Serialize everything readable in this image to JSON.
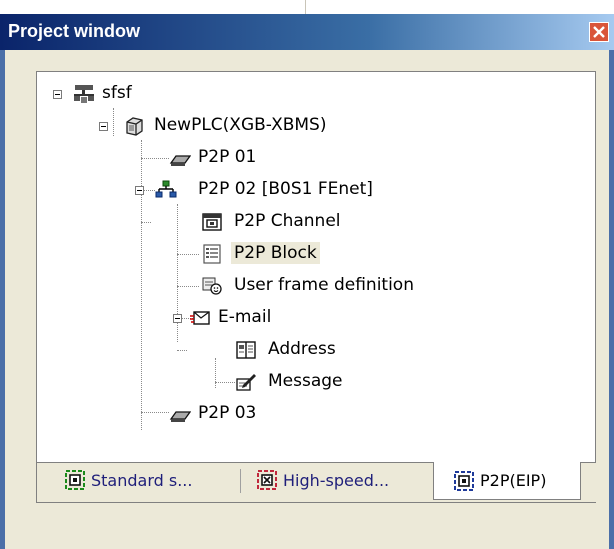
{
  "window": {
    "title": "Project window"
  },
  "tree": [
    {
      "label": "sfsf",
      "icon": "project-network-icon"
    },
    {
      "label": "NewPLC(XGB-XBMS)",
      "icon": "plc-cube-icon"
    },
    {
      "label": "P2P 01",
      "icon": "p2p-module-icon"
    },
    {
      "label": "P2P 02 [B0S1 FEnet]",
      "icon": "network-tree-icon"
    },
    {
      "label": "P2P Channel",
      "icon": "channel-icon"
    },
    {
      "label": "P2P Block",
      "icon": "block-list-icon"
    },
    {
      "label": "User frame definition",
      "icon": "user-frame-icon"
    },
    {
      "label": "E-mail",
      "icon": "email-icon"
    },
    {
      "label": "Address",
      "icon": "address-book-icon"
    },
    {
      "label": "Message",
      "icon": "message-edit-icon"
    },
    {
      "label": "P2P 03",
      "icon": "p2p-module-icon"
    }
  ],
  "tabs": [
    {
      "label": "Standard s...",
      "icon": "standard-settings-icon",
      "color": "#1a8a1a"
    },
    {
      "label": "High-speed...",
      "icon": "high-speed-icon",
      "color": "#c0283c"
    },
    {
      "label": "P2P(EIP)",
      "icon": "p2p-eip-icon",
      "color": "#1f3a9a",
      "active": true
    }
  ],
  "colors": {
    "title_bar": "#0a246a",
    "close_button": "#d9553a",
    "panel_bg": "#ece9d8"
  }
}
